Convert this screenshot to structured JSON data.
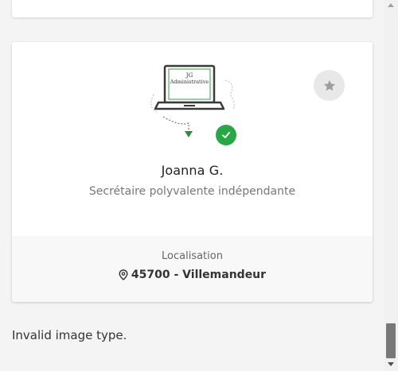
{
  "profile": {
    "logo_text_line1": "JG",
    "logo_text_line2": "Administrative",
    "name": "Joanna G.",
    "role": "Secrétaire polyvalente indépendante",
    "location_label": "Localisation",
    "location_value": "45700 - Villemandeur",
    "verified": true,
    "favorite": false
  },
  "message": {
    "invalid_image": "Invalid image type."
  },
  "colors": {
    "verified_green": "#27a844",
    "logo_green": "#3a9a4a",
    "favorite_bg": "#e8e8e8"
  },
  "icons": {
    "verified": "check-circle-icon",
    "favorite": "star-icon",
    "location": "map-pin-icon"
  }
}
